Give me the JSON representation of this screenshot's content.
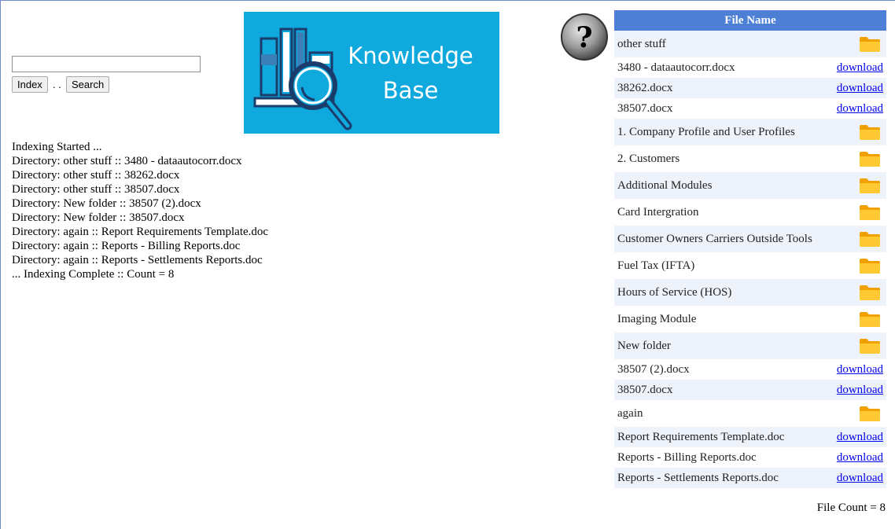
{
  "search": {
    "placeholder": "",
    "value": ""
  },
  "buttons": {
    "index": "Index",
    "separator": ". .",
    "search": "Search"
  },
  "logo": {
    "line1": "Knowledge",
    "line2": "Base"
  },
  "log": [
    "Indexing Started ...",
    "Directory: other stuff :: 3480 - dataautocorr.docx",
    "Directory: other stuff :: 38262.docx",
    "Directory: other stuff :: 38507.docx",
    "Directory: New folder :: 38507 (2).docx",
    "Directory: New folder :: 38507.docx",
    "Directory: again :: Report Requirements Template.doc",
    "Directory: again :: Reports - Billing Reports.doc",
    "Directory: again :: Reports - Settlements Reports.doc",
    "... Indexing Complete :: Count = 8"
  ],
  "table": {
    "header": "File Name",
    "download_label": "download",
    "rows": [
      {
        "name": "other stuff",
        "type": "folder"
      },
      {
        "name": "3480 - dataautocorr.docx",
        "type": "file"
      },
      {
        "name": "38262.docx",
        "type": "file"
      },
      {
        "name": "38507.docx",
        "type": "file"
      },
      {
        "name": "1. Company Profile and User Profiles",
        "type": "folder"
      },
      {
        "name": "2. Customers",
        "type": "folder"
      },
      {
        "name": "Additional Modules",
        "type": "folder"
      },
      {
        "name": "Card Intergration",
        "type": "folder"
      },
      {
        "name": "Customer Owners Carriers Outside Tools",
        "type": "folder"
      },
      {
        "name": "Fuel Tax (IFTA)",
        "type": "folder"
      },
      {
        "name": "Hours of Service (HOS)",
        "type": "folder"
      },
      {
        "name": "Imaging Module",
        "type": "folder"
      },
      {
        "name": "New folder",
        "type": "folder"
      },
      {
        "name": "38507 (2).docx",
        "type": "file"
      },
      {
        "name": "38507.docx",
        "type": "file"
      },
      {
        "name": "again",
        "type": "folder"
      },
      {
        "name": "Report Requirements Template.doc",
        "type": "file"
      },
      {
        "name": "Reports - Billing Reports.doc",
        "type": "file"
      },
      {
        "name": "Reports - Settlements Reports.doc",
        "type": "file"
      }
    ]
  },
  "file_count": "File Count = 8",
  "colors": {
    "header_bg": "#4d7fd6",
    "row_alt": "#eef2fa",
    "logo_bg": "#0fa9de",
    "folder": "#ffb300",
    "link": "#0000ee"
  },
  "icons": {
    "help": "question-mark-icon",
    "folder": "folder-icon",
    "logo": "books-magnifier-icon"
  }
}
